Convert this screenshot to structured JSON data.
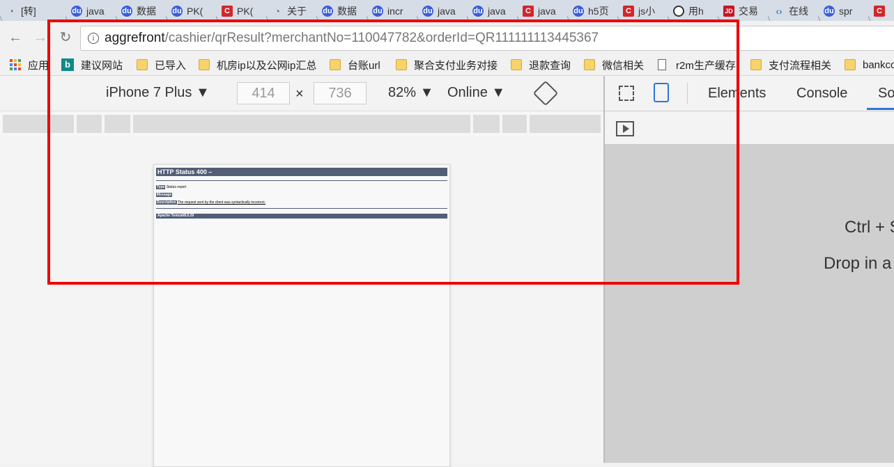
{
  "browser": {
    "tabs": [
      {
        "label": "[转]",
        "icon": "dot-icon"
      },
      {
        "label": "java",
        "icon": "baidu-icon"
      },
      {
        "label": "数据",
        "icon": "baidu-icon"
      },
      {
        "label": "PK(",
        "icon": "baidu-icon"
      },
      {
        "label": "PK(",
        "icon": "c-icon"
      },
      {
        "label": "关于",
        "icon": "dot-icon"
      },
      {
        "label": "数据",
        "icon": "baidu-icon"
      },
      {
        "label": "incr",
        "icon": "baidu-icon"
      },
      {
        "label": "java",
        "icon": "baidu-icon"
      },
      {
        "label": "java",
        "icon": "baidu-icon"
      },
      {
        "label": "java",
        "icon": "c-icon"
      },
      {
        "label": "h5页",
        "icon": "baidu-icon"
      },
      {
        "label": "js小",
        "icon": "c-icon"
      },
      {
        "label": "用h",
        "icon": "ring-icon"
      },
      {
        "label": "交易",
        "icon": "jd-icon"
      },
      {
        "label": "在线",
        "icon": "code-icon"
      },
      {
        "label": "spr",
        "icon": "baidu-icon"
      },
      {
        "label": "",
        "icon": "c-icon"
      }
    ],
    "url_host": "aggrefront",
    "url_path": "/cashier/qrResult?merchantNo=110047782&orderId=QR111111113445367",
    "bookmarks": [
      {
        "label": "应用",
        "icon": "apps-icon"
      },
      {
        "label": "建议网站",
        "icon": "bing-icon"
      },
      {
        "label": "已导入",
        "icon": "folder-icon"
      },
      {
        "label": "机房ip以及公网ip汇总",
        "icon": "folder-icon"
      },
      {
        "label": "台账url",
        "icon": "folder-icon"
      },
      {
        "label": "聚合支付业务对接",
        "icon": "folder-icon"
      },
      {
        "label": "退款查询",
        "icon": "folder-icon"
      },
      {
        "label": "微信相关",
        "icon": "folder-icon"
      },
      {
        "label": "r2m生产缓存",
        "icon": "page-icon"
      },
      {
        "label": "支付流程相关",
        "icon": "folder-icon"
      },
      {
        "label": "bankco",
        "icon": "folder-icon"
      }
    ]
  },
  "device_toolbar": {
    "device": "iPhone 7 Plus",
    "width": "414",
    "times": "×",
    "height": "736",
    "zoom": "82%",
    "throttle": "Online"
  },
  "page": {
    "title": "HTTP Status 400 –",
    "type_label": "Type",
    "type_value": "Status report",
    "message_label": "Message",
    "description_label": "Description",
    "description_value": "The request sent by the client was syntactically incorrect.",
    "footer": "Apache Tomcat/8.0.29"
  },
  "devtools": {
    "tabs": [
      "Elements",
      "Console",
      "So"
    ],
    "active_tab": "So",
    "hint_line1": "Ctrl + S",
    "hint_line2": "Drop in a"
  },
  "colors": {
    "highlight": "#ee0000",
    "tomcat_header": "#525d76",
    "devtools_accent": "#2d75d8"
  }
}
